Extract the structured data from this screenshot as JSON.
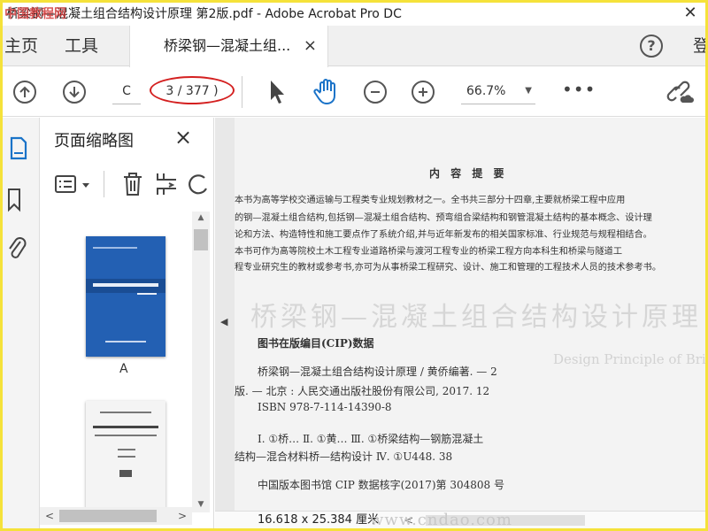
{
  "window": {
    "title": "桥梁钢—混凝土组合结构设计原理  第2版.pdf - Adobe Acrobat Pro DC",
    "watermark_top": "中国教程网"
  },
  "tabs": {
    "home": "主页",
    "tools": "工具",
    "doc": "桥梁钢—混凝土组...",
    "doc_close": "×",
    "signin": "登"
  },
  "toolbar": {
    "page_field": "C",
    "page_count": "3 / 377 )",
    "zoom": "66.7%",
    "more": "•••"
  },
  "thumbnails": {
    "title": "页面缩略图",
    "close": "×",
    "thumb1_label": "A"
  },
  "page": {
    "heading": "内  容  提  要",
    "abstract_lines": [
      "    本书为高等学校交通运输与工程类专业规划教材之一。全书共三部分十四章,主要就桥梁工程中应用",
      "的钢—混凝土组合结构,包括钢—混凝土组合结构、预弯组合梁结构和钢管混凝土结构的基本概念、设计理",
      "论和方法、构造特性和施工要点作了系统介绍,并与近年新发布的相关国家标准、行业规范与规程相结合。",
      "    本书可作为高等院校土木工程专业道路桥梁与渡河工程专业的桥梁工程方向本科生和桥梁与隧道工",
      "程专业研究生的教材或参考书,亦可为从事桥梁工程研究、设计、施工和管理的工程技术人员的技术参考书。"
    ],
    "bleed_title": "桥梁钢—混凝土组合结构设计原理",
    "bleed_sub": "Design Principle of Bridge Steel-Concrete",
    "cip_heading": "图书在版编目(CIP)数据",
    "cip_lines": [
      "桥梁钢—混凝土组合结构设计原理 / 黄侨编著. — 2",
      "版. — 北京 : 人民交通出版社股份有限公司, 2017. 12",
      "ISBN  978-7-114-14390-8"
    ],
    "cls_lines": [
      "Ⅰ. ①桥…   Ⅱ. ①黄…   Ⅲ. ①桥梁结构—钢筋混凝土",
      "结构—混合材料桥—结构设计   Ⅳ. ①U448. 38"
    ],
    "cip_number": "中国版本图书馆 CIP 数据核字(2017)第 304808 号"
  },
  "status": {
    "dims": "16.618 x 25.384 厘米",
    "watermark": "www.cndao.com"
  },
  "colors": {
    "annotation_oval": "#d42020",
    "frame": "#f5e23a",
    "rail_active_icon": "#1a73c8",
    "hand_tool": "#1a73c8"
  },
  "icons": [
    "arrow-up-circle-icon",
    "arrow-down-circle-icon",
    "pointer-icon",
    "hand-icon",
    "zoom-out-icon",
    "zoom-in-icon",
    "link-icon",
    "pages-icon",
    "bookmark-icon",
    "attachment-icon",
    "options-icon",
    "trash-icon",
    "crop-icon",
    "rotate-icon"
  ]
}
